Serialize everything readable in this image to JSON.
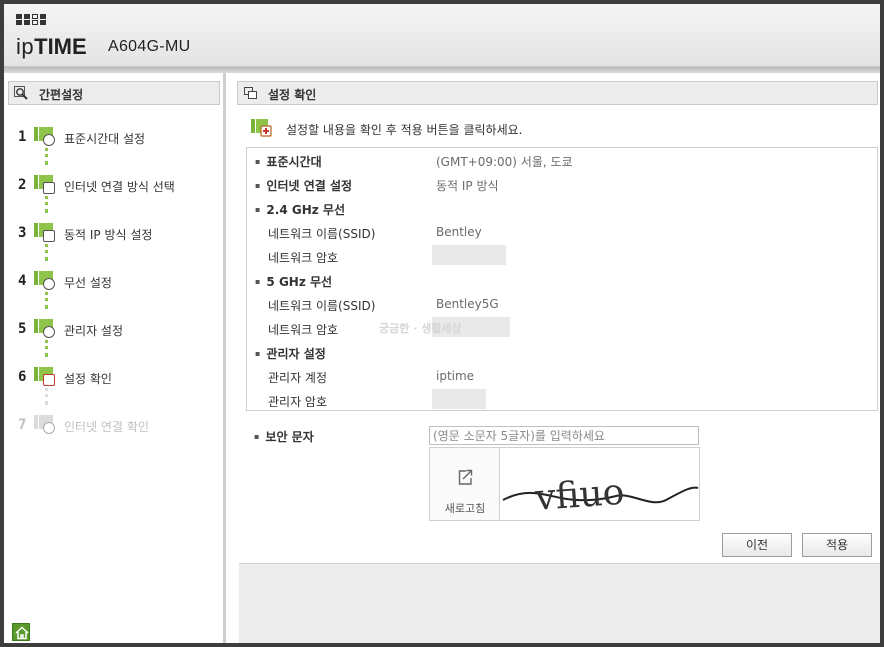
{
  "header": {
    "brand_prefix": "ip",
    "brand_bold": "TIME",
    "model": "A604G-MU"
  },
  "sidebar": {
    "title": "간편설정",
    "steps": [
      {
        "num": "1",
        "label": "표준시간대 설정",
        "icon": "clock-icon"
      },
      {
        "num": "2",
        "label": "인터넷 연결 방식 선택",
        "icon": "network-icon"
      },
      {
        "num": "3",
        "label": "동적 IP 방식 설정",
        "icon": "tree-icon"
      },
      {
        "num": "4",
        "label": "무선 설정",
        "icon": "wifi-icon"
      },
      {
        "num": "5",
        "label": "관리자 설정",
        "icon": "admin-icon"
      },
      {
        "num": "6",
        "label": "설정 확인",
        "icon": "plus-icon"
      },
      {
        "num": "7",
        "label": "인터넷 연결 확인",
        "icon": "globe-icon",
        "disabled": true
      }
    ]
  },
  "main": {
    "title": "설정 확인",
    "instruction": "설정할 내용을 확인 후 적용 버튼을 클릭하세요.",
    "summary": {
      "timezone": {
        "label": "표준시간대",
        "value": "(GMT+09:00) 서울, 도쿄"
      },
      "internet": {
        "label": "인터넷 연결 설정",
        "value": "동적 IP 방식"
      },
      "wifi24": {
        "label": "2.4 GHz 무선",
        "ssid_label": "네트워크 이름(SSID)",
        "ssid_value": "Bentley",
        "pw_label": "네트워크 암호"
      },
      "wifi5": {
        "label": "5 GHz 무선",
        "ssid_label": "네트워크 이름(SSID)",
        "ssid_value": "Bentley5G",
        "pw_label": "네트워크 암호"
      },
      "admin": {
        "label": "관리자 설정",
        "account_label": "관리자 계정",
        "account_value": "iptime",
        "pw_label": "관리자 암호"
      }
    },
    "watermark": "궁금한 · 생활세상",
    "captcha": {
      "label": "보안 문자",
      "placeholder": "(영문 소문자 5글자)를 입력하세요",
      "refresh_label": "새로고침",
      "image_text": "vfiuo"
    },
    "buttons": {
      "prev": "이전",
      "apply": "적용"
    }
  },
  "colors": {
    "accent_green": "#8dc449",
    "panel_gray": "#ececec"
  }
}
